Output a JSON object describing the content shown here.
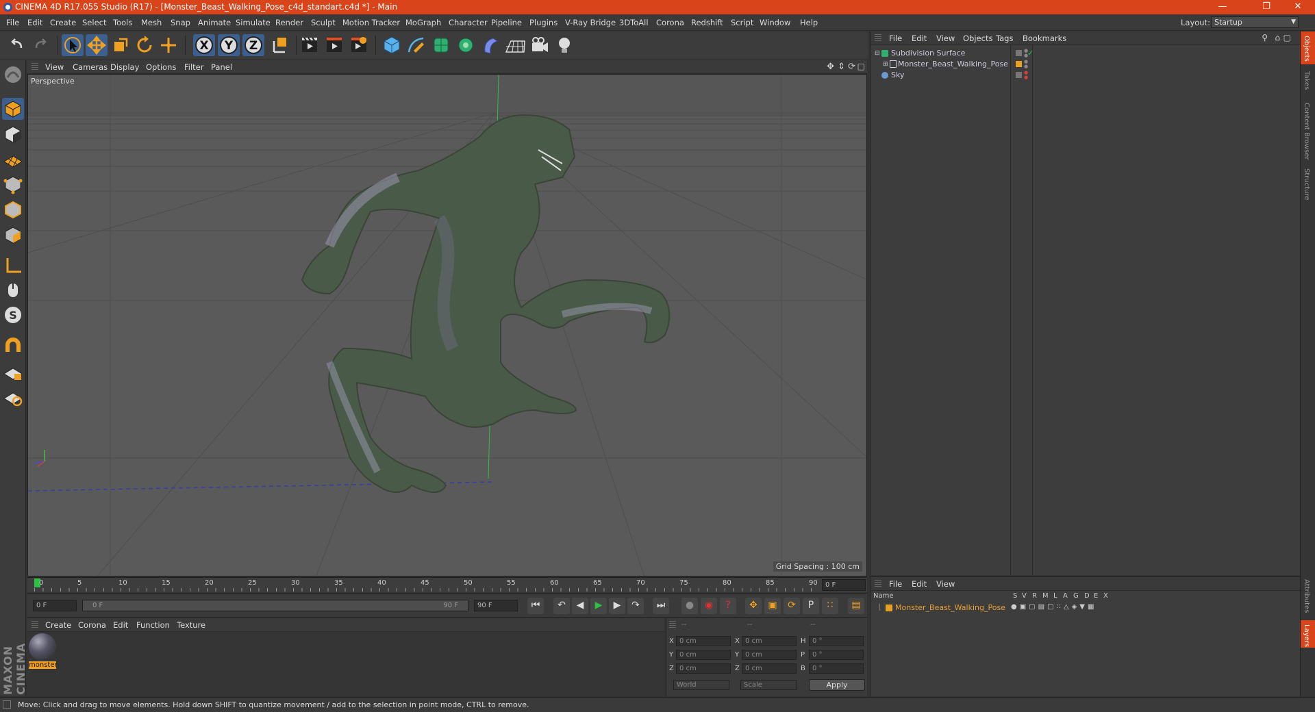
{
  "window": {
    "title": "CINEMA 4D R17.055 Studio (R17) - [Monster_Beast_Walking_Pose_c4d_standart.c4d *] - Main"
  },
  "menubar": [
    "File",
    "Edit",
    "Create",
    "Select",
    "Tools",
    "Mesh",
    "Snap",
    "Animate",
    "Simulate",
    "Render",
    "Sculpt",
    "Motion Tracker",
    "MoGraph",
    "Character",
    "Pipeline",
    "Plugins",
    "V-Ray Bridge",
    "3DToAll",
    "Corona",
    "Redshift",
    "Script",
    "Window",
    "Help"
  ],
  "layout": {
    "label": "Layout:",
    "value": "Startup"
  },
  "toolbar_axes": [
    "X",
    "Y",
    "Z"
  ],
  "viewport": {
    "menu": [
      "View",
      "Cameras",
      "Display",
      "Options",
      "Filter",
      "Panel"
    ],
    "label": "Perspective",
    "grid_spacing": "Grid Spacing : 100 cm"
  },
  "timeline": {
    "ticks": [
      "0",
      "5",
      "10",
      "15",
      "20",
      "25",
      "30",
      "35",
      "40",
      "45",
      "50",
      "55",
      "60",
      "65",
      "70",
      "75",
      "80",
      "85",
      "90"
    ],
    "end_field": "0 F",
    "start": "0 F",
    "range_start": "0 F",
    "range_end": "90 F",
    "end": "90 F"
  },
  "materials": {
    "menu": [
      "Create",
      "Corona",
      "Edit",
      "Function",
      "Texture"
    ],
    "items": [
      {
        "name": "monster"
      }
    ]
  },
  "coordinates": {
    "headers": [
      "--",
      "--",
      "--"
    ],
    "rows": [
      {
        "a": "X",
        "av": "0 cm",
        "b": "X",
        "bv": "0 cm",
        "c": "H",
        "cv": "0 °"
      },
      {
        "a": "Y",
        "av": "0 cm",
        "b": "Y",
        "bv": "0 cm",
        "c": "P",
        "cv": "0 °"
      },
      {
        "a": "Z",
        "av": "0 cm",
        "b": "Z",
        "bv": "0 cm",
        "c": "B",
        "cv": "0 °"
      }
    ],
    "mode": "World",
    "scale": "Scale",
    "apply": "Apply"
  },
  "object_manager": {
    "menu": [
      "File",
      "Edit",
      "View",
      "Objects",
      "Tags",
      "Bookmarks"
    ],
    "objects": [
      {
        "name": "Subdivision Surface"
      },
      {
        "name": "Monster_Beast_Walking_Pose"
      },
      {
        "name": "Sky"
      }
    ]
  },
  "layer_manager": {
    "menu": [
      "File",
      "Edit",
      "View"
    ],
    "columns": [
      "Name",
      "S",
      "V",
      "R",
      "M",
      "L",
      "A",
      "G",
      "D",
      "E",
      "X"
    ],
    "layers": [
      {
        "name": "Monster_Beast_Walking_Pose"
      }
    ]
  },
  "right_tabs": [
    "Objects",
    "Takes",
    "Content Browser",
    "Structure",
    "Attributes",
    "Layers"
  ],
  "branding": "MAXON CINEMA 4D",
  "status": "Move: Click and drag to move elements. Hold down SHIFT to quantize movement / add to the selection in point mode, CTRL to remove.",
  "colors": {
    "title_bar": "#d9441a",
    "selected_tool": "#3b5f8e",
    "accent_orange": "#f0a020",
    "layer_text": "#e8a030"
  }
}
